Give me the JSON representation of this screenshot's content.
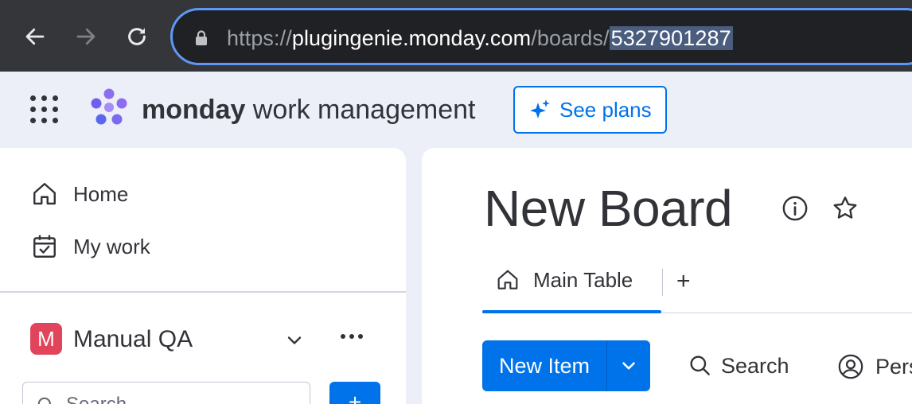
{
  "browser": {
    "url_scheme": "https://",
    "url_host": "plugingenie.monday.com",
    "url_path": "/boards/",
    "url_selected": "5327901287",
    "icons": [
      "back-icon",
      "forward-icon",
      "reload-icon",
      "lock-icon"
    ]
  },
  "header": {
    "brand_bold": "monday",
    "brand_light": " work management",
    "see_plans_label": "See plans"
  },
  "sidebar": {
    "items": [
      {
        "label": "Home",
        "icon": "home-icon"
      },
      {
        "label": "My work",
        "icon": "calendar-check-icon"
      }
    ],
    "workspace": {
      "badge": "M",
      "name": "Manual QA",
      "badge_color": "#e2445c"
    },
    "search_placeholder": "Search",
    "add_label": "+"
  },
  "board": {
    "title": "New Board",
    "tabs": [
      {
        "label": "Main Table",
        "icon": "home-icon"
      }
    ],
    "add_tab_label": "+",
    "new_item_label": "New Item",
    "search_label": "Search",
    "person_label": "Person"
  },
  "colors": {
    "accent": "#0073ea",
    "chrome_bg": "#35363a",
    "app_bg": "#eceff8"
  }
}
